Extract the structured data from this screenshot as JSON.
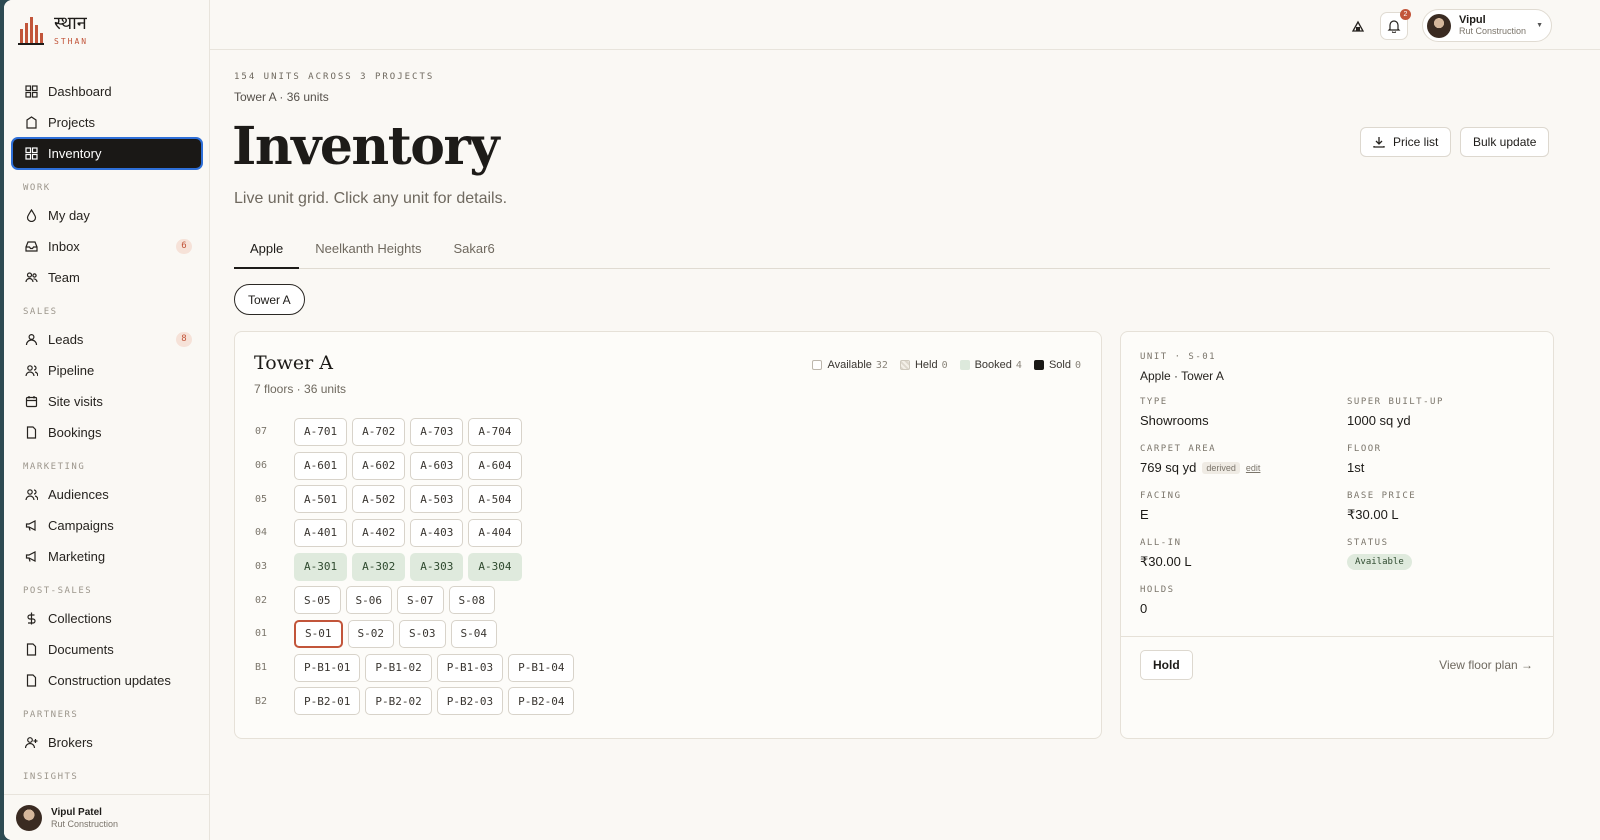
{
  "brand": {
    "name": "स्थान",
    "sub": "STHAN"
  },
  "sidebar": {
    "top": [
      {
        "label": "Dashboard",
        "icon": "grid-icon"
      },
      {
        "label": "Projects",
        "icon": "building-icon"
      },
      {
        "label": "Inventory",
        "icon": "grid-icon",
        "active": true
      }
    ],
    "sections": [
      {
        "title": "WORK",
        "items": [
          {
            "label": "My day",
            "icon": "drop-icon"
          },
          {
            "label": "Inbox",
            "icon": "inbox-icon",
            "badge": "6"
          },
          {
            "label": "Team",
            "icon": "team-icon"
          }
        ]
      },
      {
        "title": "SALES",
        "items": [
          {
            "label": "Leads",
            "icon": "user-icon",
            "badge": "8"
          },
          {
            "label": "Pipeline",
            "icon": "users-icon"
          },
          {
            "label": "Site visits",
            "icon": "calendar-icon"
          },
          {
            "label": "Bookings",
            "icon": "document-icon"
          }
        ]
      },
      {
        "title": "MARKETING",
        "items": [
          {
            "label": "Audiences",
            "icon": "users-icon"
          },
          {
            "label": "Campaigns",
            "icon": "megaphone-icon"
          },
          {
            "label": "Marketing",
            "icon": "megaphone-icon"
          }
        ]
      },
      {
        "title": "POST-SALES",
        "items": [
          {
            "label": "Collections",
            "icon": "dollar-icon"
          },
          {
            "label": "Documents",
            "icon": "document-icon"
          },
          {
            "label": "Construction updates",
            "icon": "document-icon"
          }
        ]
      },
      {
        "title": "PARTNERS",
        "items": [
          {
            "label": "Brokers",
            "icon": "user-plus-icon"
          }
        ]
      },
      {
        "title": "INSIGHTS",
        "items": []
      }
    ],
    "user": {
      "name": "Vipul Patel",
      "org": "Rut Construction"
    }
  },
  "topbar": {
    "notifications_count": "2",
    "user": {
      "name": "Vipul",
      "org": "Rut Construction"
    }
  },
  "page": {
    "eyebrow": "154 UNITS ACROSS 3 PROJECTS",
    "crumb": "Tower A · 36 units",
    "title": "Inventory",
    "subtitle": "Live unit grid. Click any unit for details.",
    "price_list_label": "Price list",
    "bulk_update_label": "Bulk update"
  },
  "tabs": [
    "Apple",
    "Neelkanth Heights",
    "Sakar6"
  ],
  "active_tab": "Apple",
  "tower_filter": "Tower A",
  "grid": {
    "title": "Tower A",
    "subtitle": "7 floors · 36 units",
    "legend": [
      {
        "label": "Available",
        "count": "32",
        "kind": "avail"
      },
      {
        "label": "Held",
        "count": "0",
        "kind": "held"
      },
      {
        "label": "Booked",
        "count": "4",
        "kind": "booked"
      },
      {
        "label": "Sold",
        "count": "0",
        "kind": "sold"
      }
    ],
    "floors": [
      {
        "label": "07",
        "units": [
          {
            "id": "A-701",
            "s": "available"
          },
          {
            "id": "A-702",
            "s": "available"
          },
          {
            "id": "A-703",
            "s": "available"
          },
          {
            "id": "A-704",
            "s": "available"
          }
        ]
      },
      {
        "label": "06",
        "units": [
          {
            "id": "A-601",
            "s": "available"
          },
          {
            "id": "A-602",
            "s": "available"
          },
          {
            "id": "A-603",
            "s": "available"
          },
          {
            "id": "A-604",
            "s": "available"
          }
        ]
      },
      {
        "label": "05",
        "units": [
          {
            "id": "A-501",
            "s": "available"
          },
          {
            "id": "A-502",
            "s": "available"
          },
          {
            "id": "A-503",
            "s": "available"
          },
          {
            "id": "A-504",
            "s": "available"
          }
        ]
      },
      {
        "label": "04",
        "units": [
          {
            "id": "A-401",
            "s": "available"
          },
          {
            "id": "A-402",
            "s": "available"
          },
          {
            "id": "A-403",
            "s": "available"
          },
          {
            "id": "A-404",
            "s": "available"
          }
        ]
      },
      {
        "label": "03",
        "units": [
          {
            "id": "A-301",
            "s": "booked"
          },
          {
            "id": "A-302",
            "s": "booked"
          },
          {
            "id": "A-303",
            "s": "booked"
          },
          {
            "id": "A-304",
            "s": "booked"
          }
        ]
      },
      {
        "label": "02",
        "units": [
          {
            "id": "S-05",
            "s": "available"
          },
          {
            "id": "S-06",
            "s": "available"
          },
          {
            "id": "S-07",
            "s": "available"
          },
          {
            "id": "S-08",
            "s": "available"
          }
        ]
      },
      {
        "label": "01",
        "units": [
          {
            "id": "S-01",
            "s": "selected"
          },
          {
            "id": "S-02",
            "s": "available"
          },
          {
            "id": "S-03",
            "s": "available"
          },
          {
            "id": "S-04",
            "s": "available"
          }
        ]
      },
      {
        "label": "B1",
        "units": [
          {
            "id": "P-B1-01",
            "s": "available"
          },
          {
            "id": "P-B1-02",
            "s": "available"
          },
          {
            "id": "P-B1-03",
            "s": "available"
          },
          {
            "id": "P-B1-04",
            "s": "available"
          }
        ]
      },
      {
        "label": "B2",
        "units": [
          {
            "id": "P-B2-01",
            "s": "available"
          },
          {
            "id": "P-B2-02",
            "s": "available"
          },
          {
            "id": "P-B2-03",
            "s": "available"
          },
          {
            "id": "P-B2-04",
            "s": "available"
          }
        ]
      }
    ]
  },
  "detail": {
    "eyebrow": "UNIT · S-01",
    "crumb": "Apple · Tower A",
    "type_label": "TYPE",
    "type": "Showrooms",
    "super_label": "SUPER BUILT-UP",
    "super": "1000 sq yd",
    "carpet_label": "CARPET AREA",
    "carpet": "769 sq yd",
    "derived": "derived",
    "edit": "edit",
    "floor_label": "FLOOR",
    "floor": "1st",
    "facing_label": "FACING",
    "facing": "E",
    "base_label": "BASE PRICE",
    "base": "₹30.00 L",
    "allin_label": "ALL-IN",
    "allin": "₹30.00 L",
    "status_label": "STATUS",
    "status": "Available",
    "holds_label": "HOLDS",
    "holds": "0",
    "hold_button": "Hold",
    "floor_plan_link": "View floor plan →"
  },
  "colors": {
    "accent": "#c2553a",
    "booked": "#dfeadd",
    "sold": "#1a1816",
    "active_nav": "#1a1816"
  }
}
